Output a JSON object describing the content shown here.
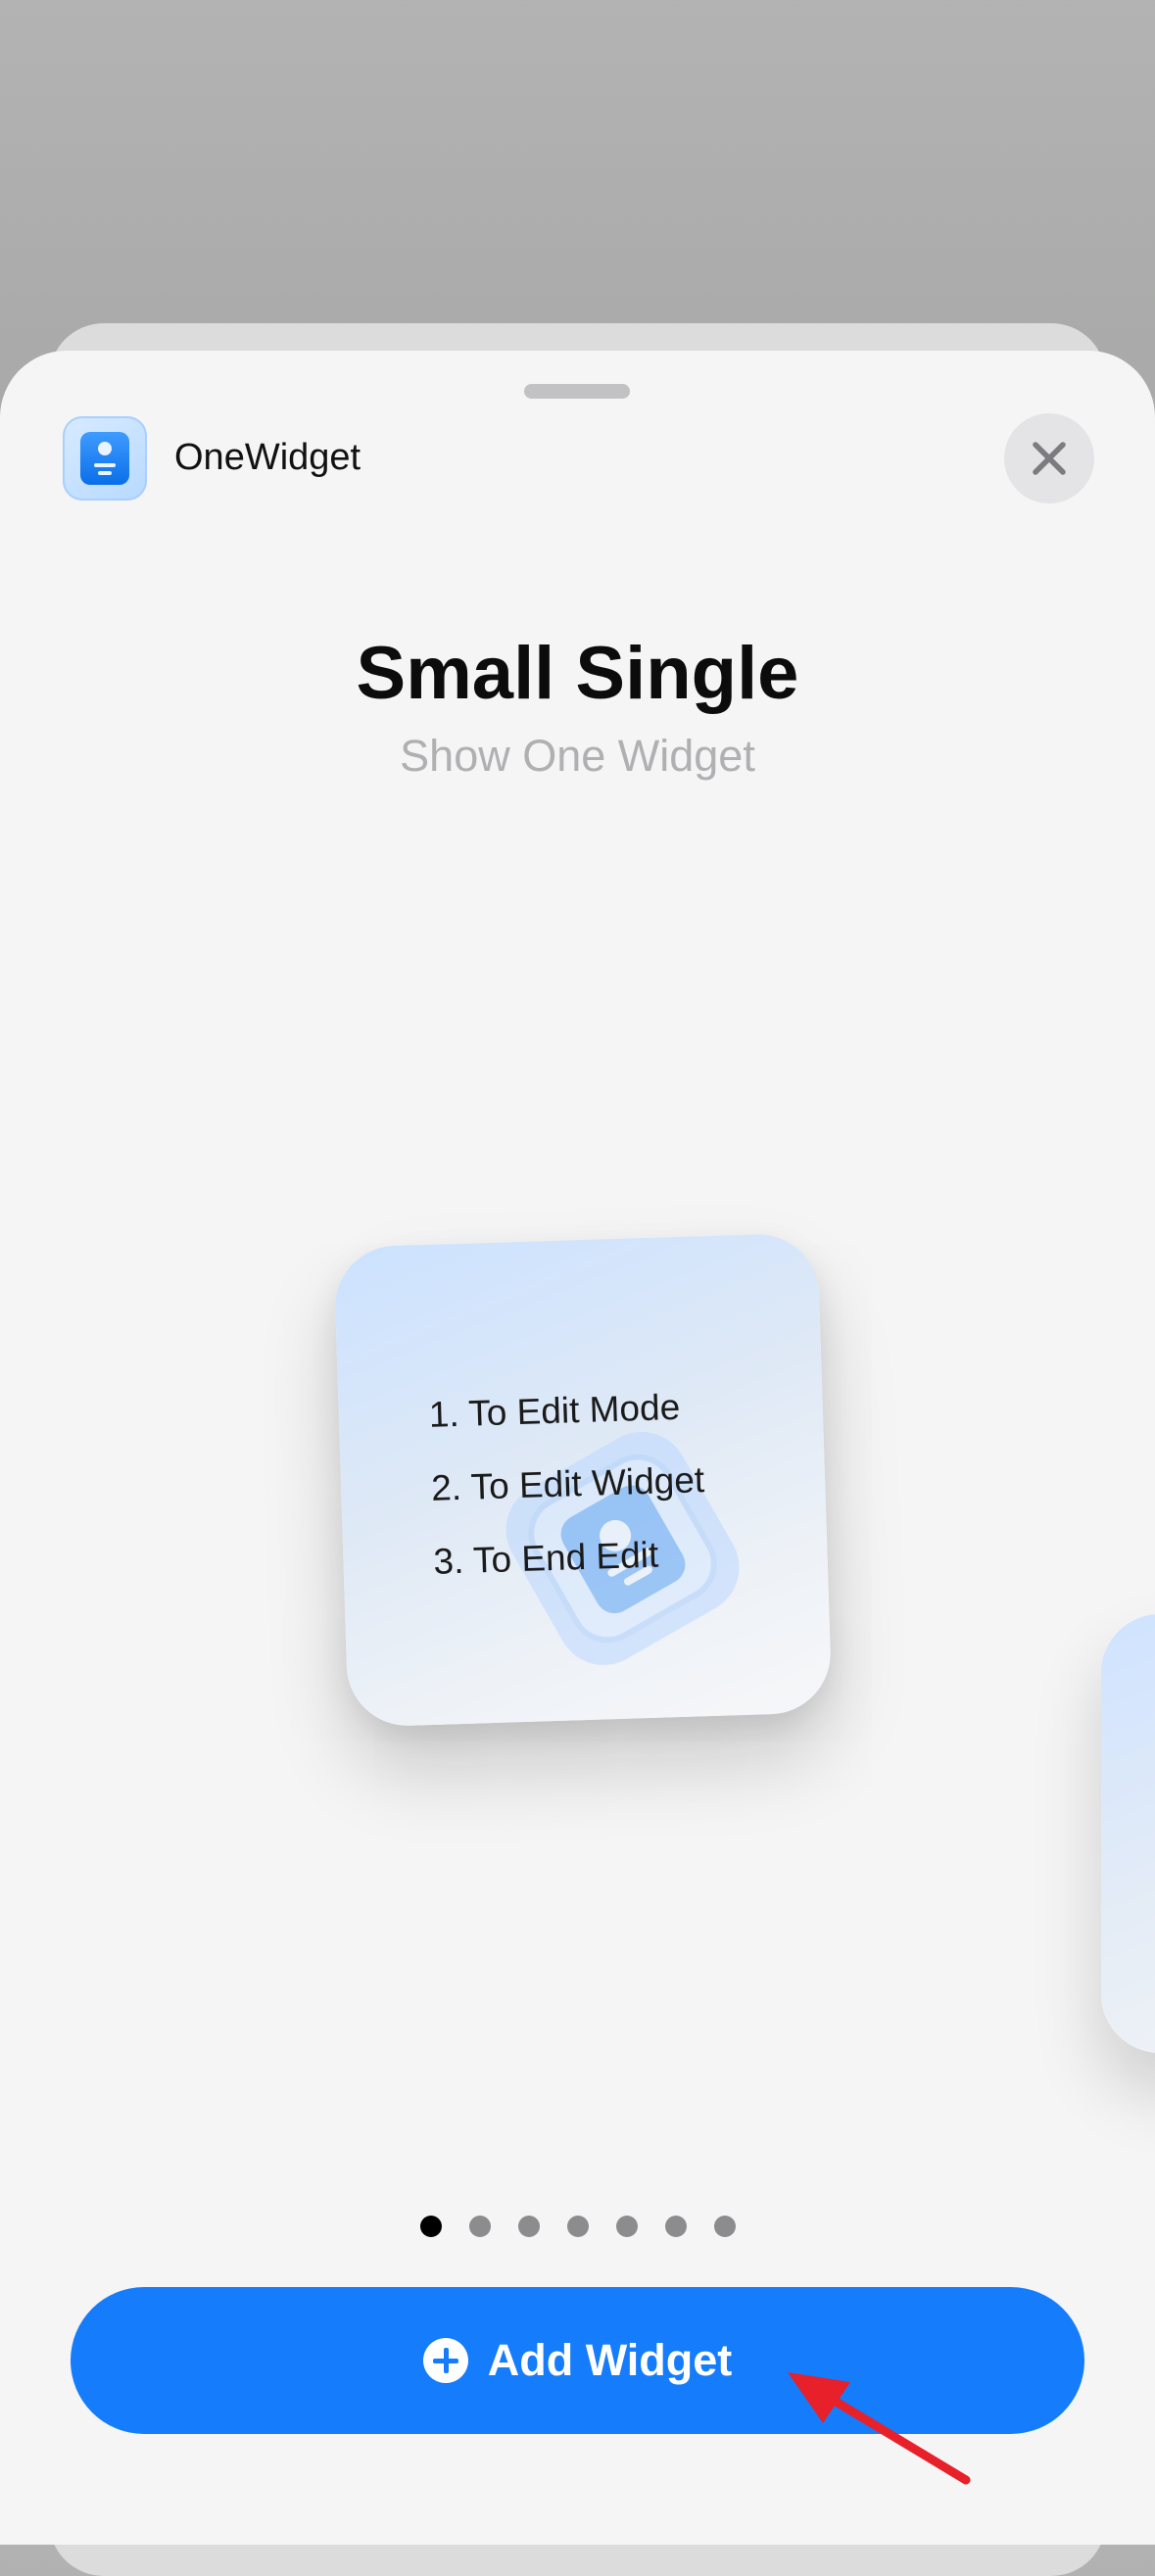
{
  "app": {
    "name": "OneWidget",
    "icon": "contact-card-icon"
  },
  "header": {
    "close_icon": "close-icon"
  },
  "widget_gallery": {
    "title": "Small Single",
    "subtitle": "Show One Widget",
    "preview": {
      "steps": [
        "1. To Edit Mode",
        "2. To Edit Widget",
        "3. To End Edit"
      ],
      "background_icon": "contact-card-icon"
    },
    "page_count": 7,
    "active_page": 1
  },
  "add_button": {
    "label": "Add Widget",
    "icon": "plus-circle-icon"
  },
  "annotation": {
    "icon": "red-arrow-icon",
    "color": "#e8202a"
  },
  "colors": {
    "accent": "#157cfb",
    "sheet": "#f5f5f5",
    "backdrop": "#a9aaa9"
  }
}
